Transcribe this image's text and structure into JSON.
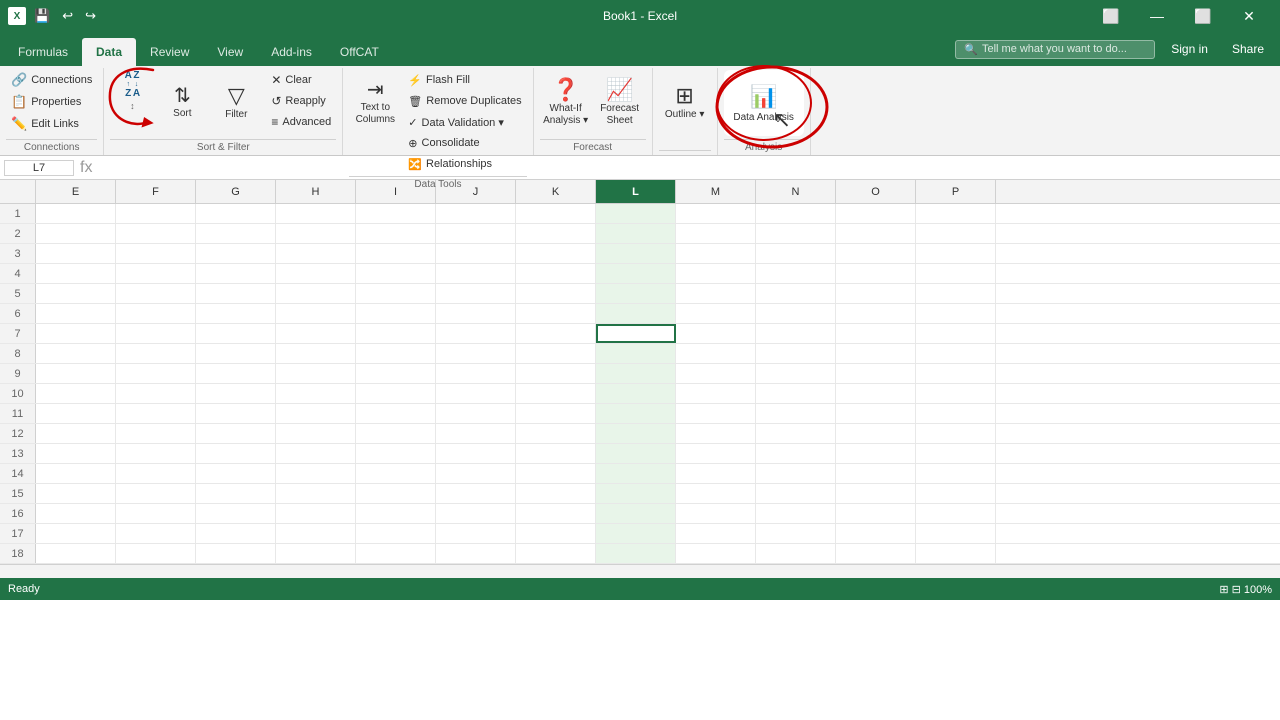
{
  "titleBar": {
    "title": "Book1 - Excel",
    "icon": "X",
    "controls": [
      "⬜",
      "—",
      "⬜",
      "✕"
    ]
  },
  "tabs": [
    {
      "id": "formulas",
      "label": "Formulas"
    },
    {
      "id": "data",
      "label": "Data",
      "active": true
    },
    {
      "id": "review",
      "label": "Review"
    },
    {
      "id": "view",
      "label": "View"
    },
    {
      "id": "addins",
      "label": "Add-ins"
    },
    {
      "id": "offcat",
      "label": "OffCAT"
    }
  ],
  "tabRight": {
    "searchPlaceholder": "Tell me what you want to do...",
    "signin": "Sign in",
    "share": "Share"
  },
  "ribbon": {
    "groups": [
      {
        "id": "connections",
        "label": "Connections",
        "items": [
          {
            "id": "connections",
            "type": "small",
            "icon": "🔗",
            "label": "Connections"
          },
          {
            "id": "properties",
            "type": "small",
            "icon": "📋",
            "label": "Properties"
          },
          {
            "id": "editlinks",
            "type": "small",
            "icon": "✏️",
            "label": "Edit Links"
          }
        ]
      },
      {
        "id": "sort-filter",
        "label": "Sort & Filter",
        "items": [
          {
            "id": "sort-az",
            "type": "sort-icon",
            "label": ""
          },
          {
            "id": "sort",
            "type": "large",
            "icon": "↕",
            "label": "Sort"
          },
          {
            "id": "filter",
            "type": "large",
            "icon": "⊟",
            "label": "Filter"
          },
          {
            "id": "sort-filter-stack",
            "type": "stack",
            "items": [
              {
                "id": "clear",
                "label": "Clear",
                "icon": "✕"
              },
              {
                "id": "reapply",
                "label": "Reapply",
                "icon": "↺"
              },
              {
                "id": "advanced",
                "label": "Advanced",
                "icon": "≡"
              }
            ]
          }
        ]
      },
      {
        "id": "data-tools",
        "label": "Data Tools",
        "items": [
          {
            "id": "text-to-columns",
            "type": "large",
            "icon": "⇥",
            "label": "Text to\nColumns"
          },
          {
            "id": "flash-fill",
            "type": "large",
            "icon": "⚡",
            "label": "Flash\nFill"
          },
          {
            "id": "remove-dupes",
            "type": "large",
            "icon": "🗑",
            "label": "Remove\nDuplicates"
          },
          {
            "id": "data-validation",
            "type": "large",
            "icon": "✓",
            "label": "Data\nValidation"
          },
          {
            "id": "consolidate",
            "type": "large",
            "icon": "⊕",
            "label": "Consolidate"
          },
          {
            "id": "relationships",
            "type": "large",
            "icon": "🔀",
            "label": "Relationships"
          }
        ]
      },
      {
        "id": "forecast",
        "label": "Forecast",
        "items": [
          {
            "id": "what-if",
            "type": "large",
            "icon": "❓",
            "label": "What-If\nAnalysis"
          },
          {
            "id": "forecast-sheet",
            "type": "large",
            "icon": "📈",
            "label": "Forecast\nSheet"
          }
        ]
      },
      {
        "id": "outline",
        "label": "",
        "items": [
          {
            "id": "outline-btn",
            "type": "large",
            "icon": "⊞",
            "label": "Outline"
          }
        ]
      },
      {
        "id": "analysis",
        "label": "Analysis",
        "items": [
          {
            "id": "data-analysis",
            "type": "analysis",
            "icon": "📊",
            "label": "Data Analysis"
          }
        ]
      }
    ]
  },
  "formulaBar": {
    "nameBox": "L7",
    "formula": ""
  },
  "columns": [
    "E",
    "F",
    "G",
    "H",
    "I",
    "J",
    "K",
    "L",
    "M",
    "N",
    "O",
    "P"
  ],
  "selectedCol": "L",
  "activeCell": {
    "row": 7,
    "col": "L"
  },
  "rowCount": 18,
  "statusBar": {
    "left": "Ready",
    "right": "⊞  ⊟  100%"
  }
}
